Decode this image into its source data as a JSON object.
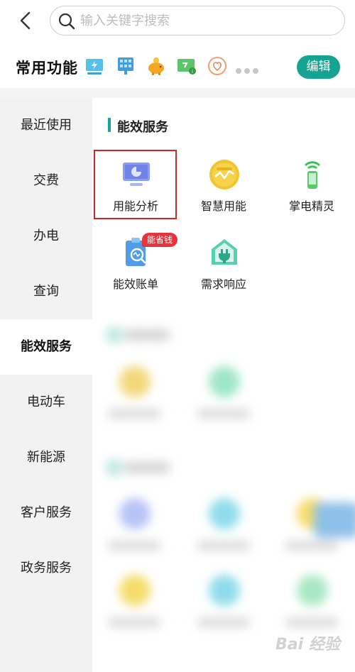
{
  "search": {
    "placeholder": "输入关键字搜索"
  },
  "common": {
    "title": "常用功能",
    "edit_label": "编辑",
    "shortcuts": [
      "monitor-icon",
      "solar-panel-icon",
      "piggy-bank-icon",
      "charge-card-icon",
      "energy-heart-icon"
    ]
  },
  "sidebar": {
    "items": [
      {
        "label": "最近使用",
        "active": false
      },
      {
        "label": "交费",
        "active": false
      },
      {
        "label": "办电",
        "active": false
      },
      {
        "label": "查询",
        "active": false
      },
      {
        "label": "能效服务",
        "active": true
      },
      {
        "label": "电动车",
        "active": false
      },
      {
        "label": "新能源",
        "active": false
      },
      {
        "label": "客户服务",
        "active": false
      },
      {
        "label": "政务服务",
        "active": false
      }
    ]
  },
  "section": {
    "title": "能效服务",
    "services": [
      {
        "label": "用能分析",
        "icon": "energy-analysis-icon",
        "highlighted": true
      },
      {
        "label": "智慧用能",
        "icon": "smart-energy-icon"
      },
      {
        "label": "掌电精灵",
        "icon": "phone-signal-icon"
      },
      {
        "label": "能效账单",
        "icon": "efficiency-bill-icon",
        "badge": "能省钱"
      },
      {
        "label": "需求响应",
        "icon": "demand-response-icon"
      }
    ]
  },
  "watermark": "Bai 经验",
  "colors": {
    "accent": "#15a392",
    "highlight": "#d0232a",
    "badge": "#e8323c",
    "sidebar_bg": "#f2f2f2"
  }
}
